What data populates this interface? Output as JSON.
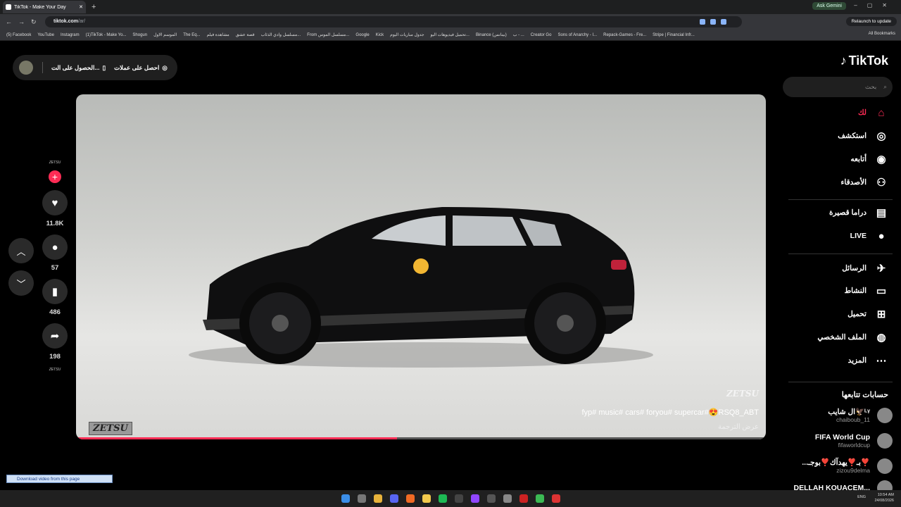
{
  "browser": {
    "tab_title": "TikTok - Make Your Day",
    "url_host": "tiktok.com",
    "url_path": "/ar/",
    "ask_gemini": "Ask Gemini",
    "relaunch": "Relaunch to update",
    "bookmarks": [
      "(5) Facebook",
      "YouTube",
      "Instagram",
      "(1)TikTok - Make Yo...",
      "Shogun",
      "الموسم الاول",
      "The Eq...",
      "مشاهدة فيلم",
      "قصة عشق",
      "مسلسل وادي الذئاب...",
      "From مسلسل الموس...",
      "Google",
      "Kick",
      "جدول مباريات اليوم",
      "تحميل فيديوهات اليو...",
      "Binance (بينانس)",
      "ب - ...",
      "Creator Go",
      "Sons of Anarchy - ا...",
      "Repack-Games - Fre...",
      "Stripe | Financial Infr..."
    ],
    "all_bookmarks": "All Bookmarks"
  },
  "topbar": {
    "coins_label": "احصل على عملات",
    "app_label": "الحصول على الت..."
  },
  "video": {
    "caption": "fyp# music# cars# foryou# supercar#😍RSQ8_ABT",
    "translate": "عرض الترجمة",
    "watermark": "ZETSU",
    "watermark_logo": "ZETSU",
    "progress": 0.465
  },
  "actions": {
    "top_tag": "ZETSU",
    "likes": "11.8K",
    "comments": "57",
    "saves": "486",
    "shares": "198",
    "bottom_tag": "ZETSU"
  },
  "sidebar": {
    "logo": "TikTok",
    "search_placeholder": "بحث",
    "nav": [
      "لك",
      "استكشف",
      "أتابعه",
      "الأصدقاء",
      "دراما قصيرة",
      "LIVE",
      "الرسائل",
      "النشاط",
      "تحميل",
      "الملف الشخصي",
      "المزيد"
    ],
    "following_title": "حسابات تتابعها",
    "accounts": [
      {
        "name": "ال شايب🦅ᴸᵞ",
        "handle": "chaiboub_11"
      },
      {
        "name": "FIFA World Cup",
        "handle": "fifaworldcup"
      },
      {
        "name": "...بـ❣️يهدآك❣️بوجـ❣️",
        "handle": "zizou9delma"
      },
      {
        "name": "DELLAH KOUACEM...",
        "handle": ""
      }
    ]
  },
  "download_bar": "Download video from this page",
  "tray": {
    "lang": "ENG",
    "time": "10:54 AM",
    "date": "24/08/2026"
  }
}
